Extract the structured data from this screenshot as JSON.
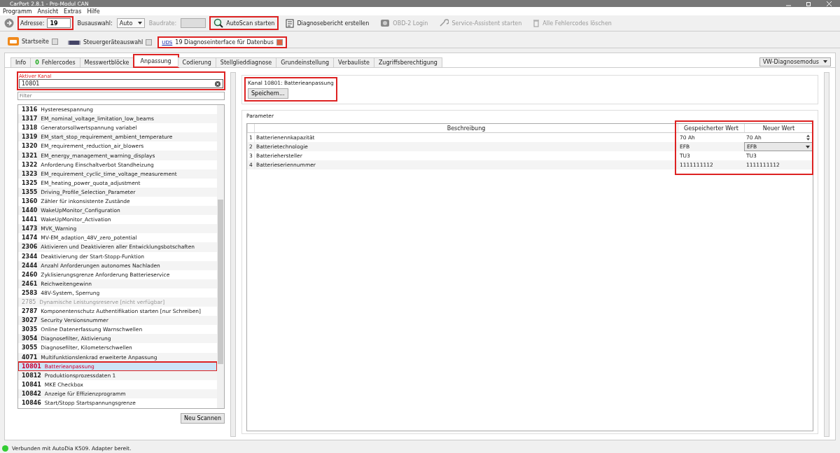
{
  "window": {
    "title": "CarPort 2.8.1 - Pro-Modul CAN"
  },
  "menu": [
    "Programm",
    "Ansicht",
    "Extras",
    "Hilfe"
  ],
  "toolbar": {
    "address_label": "Adresse:",
    "address_value": "19",
    "address_highlighted": true,
    "bus_label": "Busauswahl:",
    "bus_value": "Auto",
    "baud_label": "Baudrate:",
    "buttons": [
      {
        "label": "AutoScan starten",
        "disabled": false,
        "highlighted": true
      },
      {
        "label": "Diagnosebericht erstellen",
        "disabled": false,
        "highlighted": false
      },
      {
        "label": "OBD-2 Login",
        "disabled": true,
        "highlighted": false
      },
      {
        "label": "Service-Assistent starten",
        "disabled": true,
        "highlighted": false
      },
      {
        "label": "Alle Fehlercodes löschen",
        "disabled": true,
        "highlighted": false
      }
    ]
  },
  "doc_tabs": [
    {
      "label": "Startseite",
      "selected": false,
      "highlighted": false
    },
    {
      "label": "Steuergeräteauswahl",
      "selected": false,
      "highlighted": false
    },
    {
      "prefix": "UDS",
      "label": "19 Diagnoseinterface für Datenbus",
      "selected": true,
      "highlighted": true
    }
  ],
  "tabs": [
    {
      "label": "Info",
      "selected": false
    },
    {
      "count": "0",
      "label": "Fehlercodes",
      "selected": false
    },
    {
      "label": "Messwertblöcke",
      "selected": false
    },
    {
      "label": "Anpassung",
      "selected": true
    },
    {
      "label": "Codierung",
      "selected": false
    },
    {
      "label": "Stellglieddiagnose",
      "selected": false
    },
    {
      "label": "Grundeinstellung",
      "selected": false
    },
    {
      "label": "Verbauliste",
      "selected": false
    },
    {
      "label": "Zugriffsberechtigung",
      "selected": false
    }
  ],
  "mode_select": "VW-Diagnosemodus",
  "channel_panel": {
    "label": "Aktiver Kanal",
    "value": "10801",
    "filter_placeholder": "Filter",
    "channels": [
      {
        "number": "1316",
        "name": "Hysteresespannung",
        "available": true,
        "selected": false
      },
      {
        "number": "1317",
        "name": "EM_nominal_voltage_limitation_low_beams",
        "available": true,
        "selected": false
      },
      {
        "number": "1318",
        "name": "Generatorsollwertspannung variabel",
        "available": true,
        "selected": false
      },
      {
        "number": "1319",
        "name": "EM_start_stop_requirement_ambient_temperature",
        "available": true,
        "selected": false
      },
      {
        "number": "1320",
        "name": "EM_requirement_reduction_air_blowers",
        "available": true,
        "selected": false
      },
      {
        "number": "1321",
        "name": "EM_energy_management_warning_displays",
        "available": true,
        "selected": false
      },
      {
        "number": "1322",
        "name": "Anforderung Einschaltverbot Standheizung",
        "available": true,
        "selected": false
      },
      {
        "number": "1323",
        "name": "EM_requirement_cyclic_time_voltage_measurement",
        "available": true,
        "selected": false
      },
      {
        "number": "1325",
        "name": "EM_heating_power_quota_adjustment",
        "available": true,
        "selected": false
      },
      {
        "number": "1355",
        "name": "Driving_Profile_Selection_Parameter",
        "available": true,
        "selected": false
      },
      {
        "number": "1360",
        "name": "Zähler für inkonsistente Zustände",
        "available": true,
        "selected": false
      },
      {
        "number": "1440",
        "name": "WakeUpMonitor_Configuration",
        "available": true,
        "selected": false
      },
      {
        "number": "1441",
        "name": "WakeUpMonitor_Activation",
        "available": true,
        "selected": false
      },
      {
        "number": "1473",
        "name": "MVK_Warning",
        "available": true,
        "selected": false
      },
      {
        "number": "1474",
        "name": "MV-EM_adaption_48V_zero_potential",
        "available": true,
        "selected": false
      },
      {
        "number": "2306",
        "name": "Aktivieren und Deaktivieren aller Entwicklungsbotschaften",
        "available": true,
        "selected": false
      },
      {
        "number": "2344",
        "name": "Deaktivierung der Start-Stopp-Funktion",
        "available": true,
        "selected": false
      },
      {
        "number": "2444",
        "name": "Anzahl Anforderungen autonomes Nachladen",
        "available": true,
        "selected": false
      },
      {
        "number": "2460",
        "name": "Zyklisierungsgrenze Anforderung Batterieservice",
        "available": true,
        "selected": false
      },
      {
        "number": "2461",
        "name": "Reichweitengewinn",
        "available": true,
        "selected": false
      },
      {
        "number": "2583",
        "name": "48V-System, Sperrung",
        "available": true,
        "selected": false
      },
      {
        "number": "2785",
        "name": "Dynamische Leistungsreserve [nicht verfügbar]",
        "available": false,
        "selected": false
      },
      {
        "number": "2787",
        "name": "Komponentenschutz Authentifikation starten [nur Schreiben]",
        "available": true,
        "selected": false
      },
      {
        "number": "3027",
        "name": "Security Versionsnummer",
        "available": true,
        "selected": false
      },
      {
        "number": "3035",
        "name": "Online Datenerfassung Warnschwellen",
        "available": true,
        "selected": false
      },
      {
        "number": "3054",
        "name": "Diagnosefilter, Aktivierung",
        "available": true,
        "selected": false
      },
      {
        "number": "3055",
        "name": "Diagnosefilter, Kilometerschwellen",
        "available": true,
        "selected": false
      },
      {
        "number": "4071",
        "name": "Multifunktionslenkrad erweiterte Anpassung",
        "available": true,
        "selected": false
      },
      {
        "number": "10801",
        "name": "Batterieanpassung",
        "available": true,
        "selected": true
      },
      {
        "number": "10812",
        "name": "Produktionsprozessdaten 1",
        "available": true,
        "selected": false
      },
      {
        "number": "10841",
        "name": "MKE Checkbox",
        "available": true,
        "selected": false
      },
      {
        "number": "10842",
        "name": "Anzeige für Effizienzprogramm",
        "available": true,
        "selected": false
      },
      {
        "number": "10846",
        "name": "Start/Stopp Startspannungsgrenze",
        "available": true,
        "selected": false
      }
    ],
    "rescan_button": "Neu Scannen"
  },
  "channel_group": {
    "title": "Kanal 10801: Batterieanpassung",
    "save_button": "Speichern..."
  },
  "parameters": {
    "title": "Parameter",
    "columns": [
      "Beschreibung",
      "Gespeicherter Wert",
      "Neuer Wert"
    ],
    "rows": [
      {
        "index": "1",
        "description": "Batterienennkapazität",
        "stored": "70 Ah",
        "new": "70 Ah",
        "kind": "spin"
      },
      {
        "index": "2",
        "description": "Batterietechnologie",
        "stored": "EFB",
        "new": "EFB",
        "kind": "select"
      },
      {
        "index": "3",
        "description": "Batteriehersteller",
        "stored": "TU3",
        "new": "TU3",
        "kind": "text"
      },
      {
        "index": "4",
        "description": "Batterieseriennummer",
        "stored": "1111111112",
        "new": "1111111112",
        "kind": "text"
      }
    ]
  },
  "status_bar": {
    "connected": true,
    "text": "Verbunden mit AutoDia K509. Adapter bereit."
  }
}
